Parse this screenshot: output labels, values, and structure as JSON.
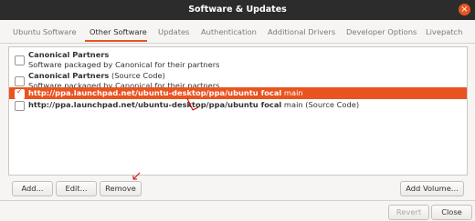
{
  "window": {
    "title": "Software & Updates",
    "close_glyph": "×"
  },
  "tabs": [
    {
      "label": "Ubuntu Software",
      "active": false
    },
    {
      "label": "Other Software",
      "active": true
    },
    {
      "label": "Updates",
      "active": false
    },
    {
      "label": "Authentication",
      "active": false
    },
    {
      "label": "Additional Drivers",
      "active": false
    },
    {
      "label": "Developer Options",
      "active": false
    },
    {
      "label": "Livepatch",
      "active": false
    }
  ],
  "sources": [
    {
      "title": "Canonical Partners",
      "subtitle": "Software packaged by Canonical for their partners",
      "checked": false,
      "selected": false
    },
    {
      "title": "Canonical Partners",
      "title_suffix": " (Source Code)",
      "subtitle": "Software packaged by Canonical for their partners",
      "checked": false,
      "selected": false
    },
    {
      "title": "http://ppa.launchpad.net/ubuntu-desktop/ppa/ubuntu focal",
      "title_suffix": " main",
      "checked": true,
      "selected": true
    },
    {
      "title": "http://ppa.launchpad.net/ubuntu-desktop/ppa/ubuntu focal",
      "title_suffix": " main (Source Code)",
      "checked": false,
      "selected": false
    }
  ],
  "buttons": {
    "add": "Add...",
    "edit": "Edit...",
    "remove": "Remove",
    "add_volume": "Add Volume...",
    "revert": "Revert",
    "close": "Close"
  },
  "colors": {
    "accent": "#e95420",
    "annotation": "#d40000"
  }
}
